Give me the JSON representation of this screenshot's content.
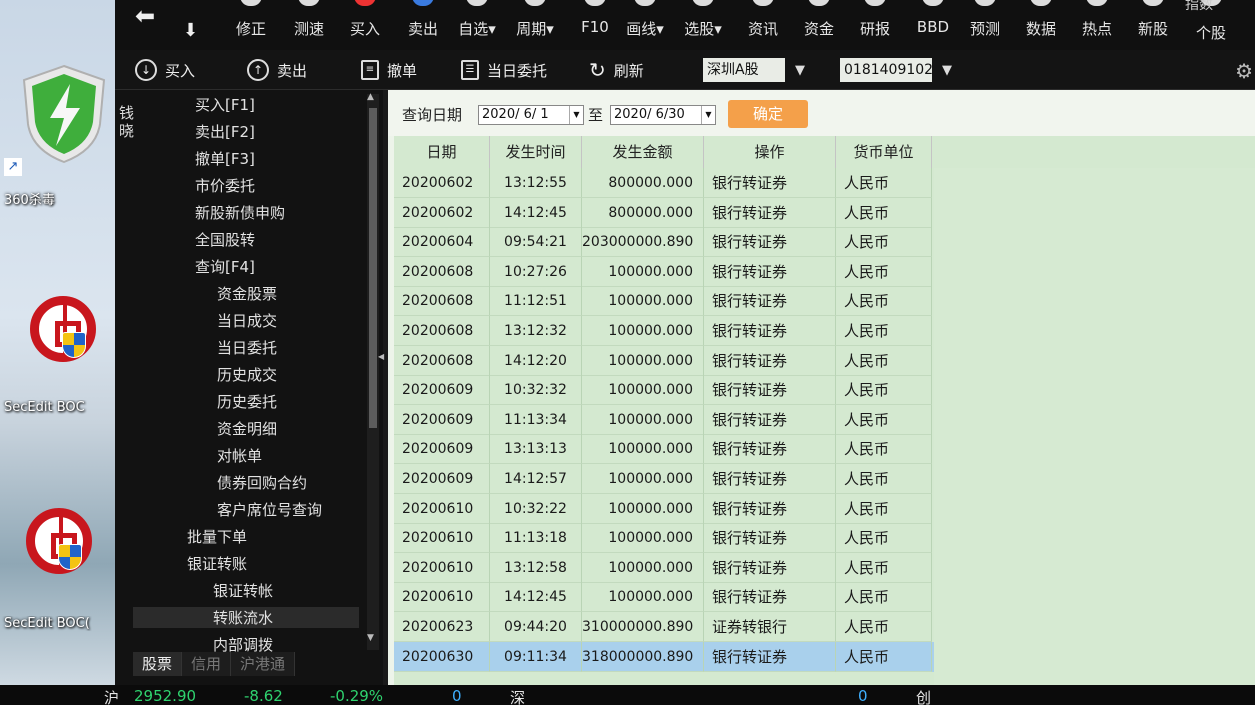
{
  "desktop": {
    "icons": [
      {
        "label": "360杀毒"
      },
      {
        "label": "SecEdit BOC"
      },
      {
        "label": "SecEdit BOC("
      }
    ]
  },
  "toolbar": {
    "items": [
      "修正",
      "测速",
      "买入",
      "卖出",
      "自选▾",
      "周期▾",
      "F10",
      "画线▾",
      "选股▾",
      "资讯",
      "资金",
      "研报",
      "BBD",
      "预测",
      "数据",
      "热点",
      "新股",
      "个股"
    ],
    "extra_top": "指数"
  },
  "actionbar": {
    "buy": "买入",
    "sell": "卖出",
    "cancel": "撤单",
    "today_orders": "当日委托",
    "refresh": "刷新",
    "market": "深圳A股",
    "account": "0181409102"
  },
  "sidebar": {
    "vertical_label": "钱晓",
    "menu": [
      {
        "label": "买入[F1]",
        "level": 1
      },
      {
        "label": "卖出[F2]",
        "level": 1
      },
      {
        "label": "撤单[F3]",
        "level": 1
      },
      {
        "label": "市价委托",
        "level": 1
      },
      {
        "label": "新股新债申购",
        "level": 1
      },
      {
        "label": "全国股转",
        "level": 1
      },
      {
        "label": "查询[F4]",
        "level": 1
      },
      {
        "label": "资金股票",
        "level": 2
      },
      {
        "label": "当日成交",
        "level": 2
      },
      {
        "label": "当日委托",
        "level": 2
      },
      {
        "label": "历史成交",
        "level": 2
      },
      {
        "label": "历史委托",
        "level": 2
      },
      {
        "label": "资金明细",
        "level": 2
      },
      {
        "label": "对帐单",
        "level": 2
      },
      {
        "label": "债券回购合约",
        "level": 2
      },
      {
        "label": "客户席位号查询",
        "level": 2
      },
      {
        "label": "批量下单",
        "level": 1
      },
      {
        "label": "银证转账",
        "level": 1
      },
      {
        "label": "银证转帐",
        "level": 2
      },
      {
        "label": "转账流水",
        "level": 2,
        "selected": true
      },
      {
        "label": "内部调拨",
        "level": 2
      }
    ],
    "tabs": [
      "股票",
      "信用",
      "沪港通"
    ]
  },
  "query": {
    "label": "查询日期",
    "start_date": "2020/ 6/ 1",
    "to_label": "至",
    "end_date": "2020/ 6/30",
    "confirm": "确定"
  },
  "table": {
    "headers": [
      "日期",
      "发生时间",
      "发生金额",
      "操作",
      "货币单位"
    ],
    "rows": [
      [
        "20200602",
        "13:12:55",
        "800000.000",
        "银行转证券",
        "人民币"
      ],
      [
        "20200602",
        "14:12:45",
        "800000.000",
        "银行转证券",
        "人民币"
      ],
      [
        "20200604",
        "09:54:21",
        "203000000.890",
        "银行转证券",
        "人民币"
      ],
      [
        "20200608",
        "10:27:26",
        "100000.000",
        "银行转证券",
        "人民币"
      ],
      [
        "20200608",
        "11:12:51",
        "100000.000",
        "银行转证券",
        "人民币"
      ],
      [
        "20200608",
        "13:12:32",
        "100000.000",
        "银行转证券",
        "人民币"
      ],
      [
        "20200608",
        "14:12:20",
        "100000.000",
        "银行转证券",
        "人民币"
      ],
      [
        "20200609",
        "10:32:32",
        "100000.000",
        "银行转证券",
        "人民币"
      ],
      [
        "20200609",
        "11:13:34",
        "100000.000",
        "银行转证券",
        "人民币"
      ],
      [
        "20200609",
        "13:13:13",
        "100000.000",
        "银行转证券",
        "人民币"
      ],
      [
        "20200609",
        "14:12:57",
        "100000.000",
        "银行转证券",
        "人民币"
      ],
      [
        "20200610",
        "10:32:22",
        "100000.000",
        "银行转证券",
        "人民币"
      ],
      [
        "20200610",
        "11:13:18",
        "100000.000",
        "银行转证券",
        "人民币"
      ],
      [
        "20200610",
        "13:12:58",
        "100000.000",
        "银行转证券",
        "人民币"
      ],
      [
        "20200610",
        "14:12:45",
        "100000.000",
        "银行转证券",
        "人民币"
      ],
      [
        "20200623",
        "09:44:20",
        "310000000.890",
        "证券转银行",
        "人民币"
      ],
      [
        "20200630",
        "09:11:34",
        "318000000.890",
        "银行转证券",
        "人民币"
      ]
    ],
    "selected_row": 16
  },
  "ticker": {
    "index_name": "沪",
    "value": "2952.90",
    "change": "-8.62",
    "pct": "-0.29%",
    "vol": "0",
    "index2": "深",
    "vol2": "0",
    "index3": "创"
  },
  "colors": {
    "confirm_button": "#f4a04a",
    "selected_row": "#a9d0ec",
    "grid_bg": "#d4e9d0",
    "ticker_up": "#ff4040",
    "ticker_down": "#2fd36f"
  }
}
